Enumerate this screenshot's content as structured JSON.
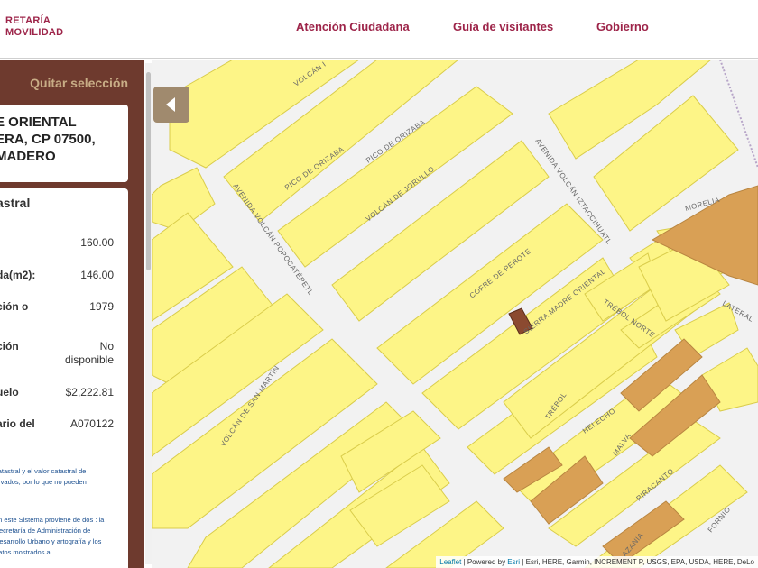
{
  "header": {
    "logo_line1": "RETARÍA",
    "logo_line2": "MOVILIDAD",
    "nav": [
      "Atención Ciudadana",
      "Guía de visitantes",
      "Gobierno"
    ]
  },
  "panel": {
    "clear_selection": "Quitar selección",
    "address": [
      "E ORIENTAL",
      "ERA, CP 07500,",
      "MADERO"
    ],
    "section_title": "astral",
    "rows": [
      {
        "label": ":",
        "value": "160.00"
      },
      {
        "label": "da(m2):",
        "value": "146.00"
      },
      {
        "label": "ción o",
        "value": "1979"
      },
      {
        "label": "ción",
        "value": "No disponible"
      },
      {
        "label": "uelo",
        "value": "$2,222.81"
      },
      {
        "label": "ario del",
        "value": "A070122"
      }
    ],
    "note1": "catastral y el valor catastral de ervados, por lo que no pueden",
    "note2": "en este Sistema proviene de dos : la Secretaría de Administración de Desarrollo Urbano y artografía y los datos mostrados a"
  },
  "map": {
    "streets": [
      "VOLCÁN I",
      "PICO DE ORIZABA",
      "PICO DE ORIZABA",
      "VOLCÁN DE JORULLO",
      "AVENIDA VOLCÁN POPOCATÉPETL",
      "AVENIDA VOLCÁN IZTACCIHUATL",
      "COFRE DE PEROTE",
      "SIERRA MADRE ORIENTAL",
      "TRÉBOL NORTE",
      "MORELIA",
      "LATERAL",
      "VOLCÁN DE SAN MARTÍN",
      "TRÉBOL",
      "HELECHO",
      "MALVA",
      "PIRACANTO",
      "FORNIO",
      "AZANIA"
    ],
    "attribution_leaflet": "Leaflet",
    "attribution_mid": " | Powered by ",
    "attribution_esri": "Esri",
    "attribution_rest": " | Esri, HERE, Garmin, INCREMENT P, USGS, EPA, USDA, HERE, DeLo",
    "colors": {
      "parcel": "#fdf587",
      "parcel_border": "#d9cc4a",
      "highlight": "#b07a48",
      "selected": "#8b4a30",
      "zone": "#d9a055"
    }
  }
}
